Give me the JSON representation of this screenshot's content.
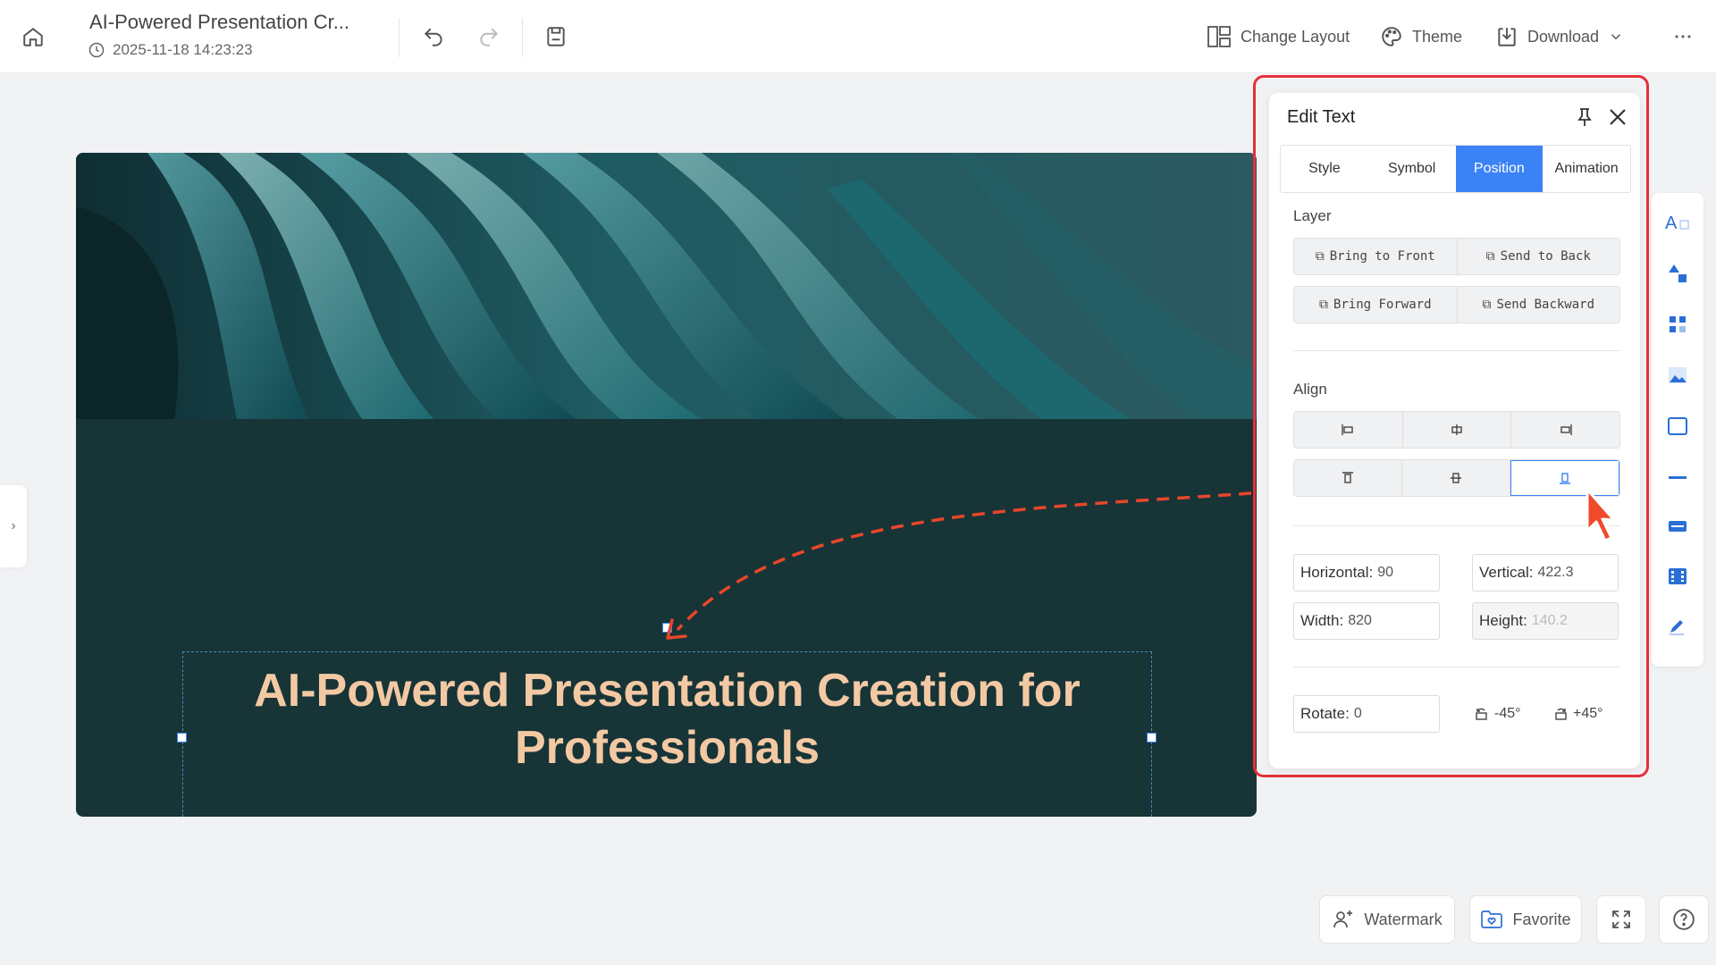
{
  "header": {
    "doc_title": "AI-Powered Presentation Cr...",
    "timestamp": "2025-11-18 14:23:23",
    "change_layout_label": "Change Layout",
    "theme_label": "Theme",
    "download_label": "Download"
  },
  "slide": {
    "title": "AI-Powered Presentation Creation for Professionals",
    "background_color": "#173437",
    "title_color": "#f3c9a4"
  },
  "panel": {
    "title": "Edit Text",
    "tabs": [
      {
        "label": "Style",
        "active": false
      },
      {
        "label": "Symbol",
        "active": false
      },
      {
        "label": "Position",
        "active": true
      },
      {
        "label": "Animation",
        "active": false
      }
    ],
    "layer_label": "Layer",
    "layer_buttons": [
      "Bring to Front",
      "Send to Back",
      "Bring Forward",
      "Send Backward"
    ],
    "align_label": "Align",
    "align_buttons": [
      "align-left-icon",
      "align-center-horizontal-icon",
      "align-right-icon",
      "align-top-icon",
      "align-middle-vertical-icon",
      "align-bottom-icon"
    ],
    "selected_align": "align-bottom-icon",
    "horizontal_label": "Horizontal:",
    "horizontal_value": "90",
    "vertical_label": "Vertical:",
    "vertical_value": "422.3",
    "width_label": "Width:",
    "width_value": "820",
    "height_label": "Height:",
    "height_value": "140.2",
    "rotate_label": "Rotate:",
    "rotate_value": "0",
    "rotate_ccw_label": "-45°",
    "rotate_cw_label": "+45°"
  },
  "right_toolbar": [
    "text-icon",
    "shapes-icon",
    "elements-icon",
    "image-icon",
    "frame-icon",
    "line-icon",
    "textbox-icon",
    "video-icon",
    "draw-icon"
  ],
  "footer": {
    "watermark_label": "Watermark",
    "favorite_label": "Favorite"
  },
  "colors": {
    "accent": "#3b82f6",
    "highlight": "#e5303a",
    "annotation_arrow": "#e8462a"
  }
}
